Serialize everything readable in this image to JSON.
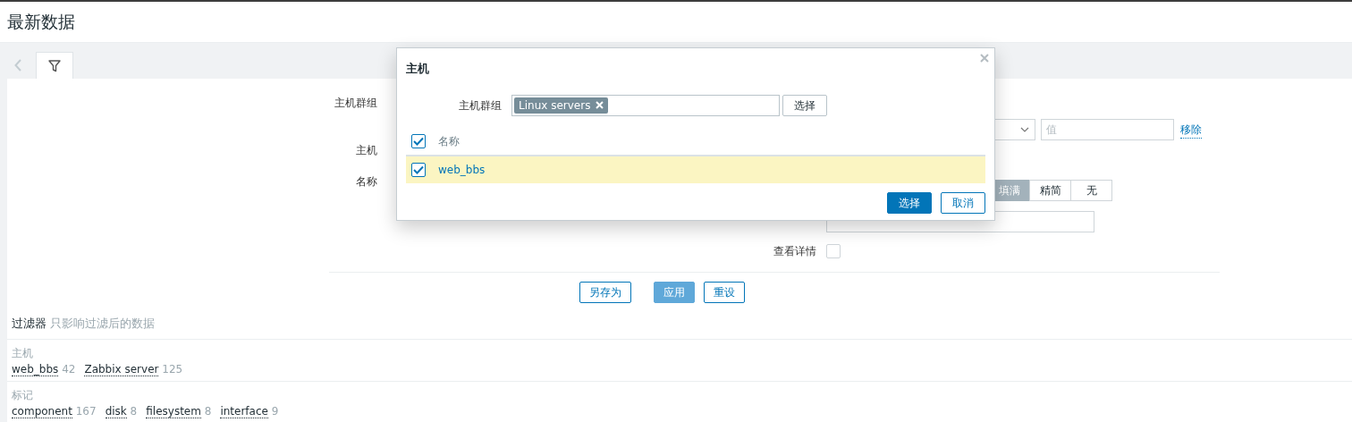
{
  "page_title": "最新数据",
  "filter_tabs": [
    {
      "kind": "back",
      "selected": false
    },
    {
      "kind": "filter",
      "selected": true
    }
  ],
  "filter_form": {
    "left_labels": [
      "主机群组",
      "主机",
      "名称"
    ],
    "tag_value": {
      "placeholder": "值"
    },
    "remove_link": "移除",
    "tag_display": [
      {
        "label": "填满",
        "selected": true
      },
      {
        "label": "精简",
        "selected": false
      },
      {
        "label": "无",
        "selected": false
      }
    ],
    "show_details": {
      "label": "查看详情",
      "checked": false
    },
    "buttons": [
      {
        "label": "另存为",
        "kind": "outline"
      },
      {
        "label": "应用",
        "kind": "primary"
      },
      {
        "label": "重设",
        "kind": "outline"
      }
    ]
  },
  "subfilter": {
    "title": "过滤器",
    "note": "只影响过滤后的数据",
    "groups": [
      {
        "title": "主机",
        "items": [
          {
            "label": "web_bbs",
            "count": "42"
          },
          {
            "label": "Zabbix server",
            "count": "125"
          }
        ]
      },
      {
        "title": "标记",
        "items": [
          {
            "label": "component",
            "count": "167"
          },
          {
            "label": "disk",
            "count": "8"
          },
          {
            "label": "filesystem",
            "count": "8"
          },
          {
            "label": "interface",
            "count": "9"
          }
        ]
      }
    ]
  },
  "dialog": {
    "title": "主机",
    "group_label": "主机群组",
    "group_tags": [
      "Linux servers"
    ],
    "select_button": "选择",
    "header_checked": true,
    "columns": [
      "名称"
    ],
    "rows": [
      {
        "name": "web_bbs",
        "selected": true
      }
    ],
    "buttons": [
      {
        "label": "选择",
        "kind": "primary"
      },
      {
        "label": "取消",
        "kind": "outline"
      }
    ]
  }
}
